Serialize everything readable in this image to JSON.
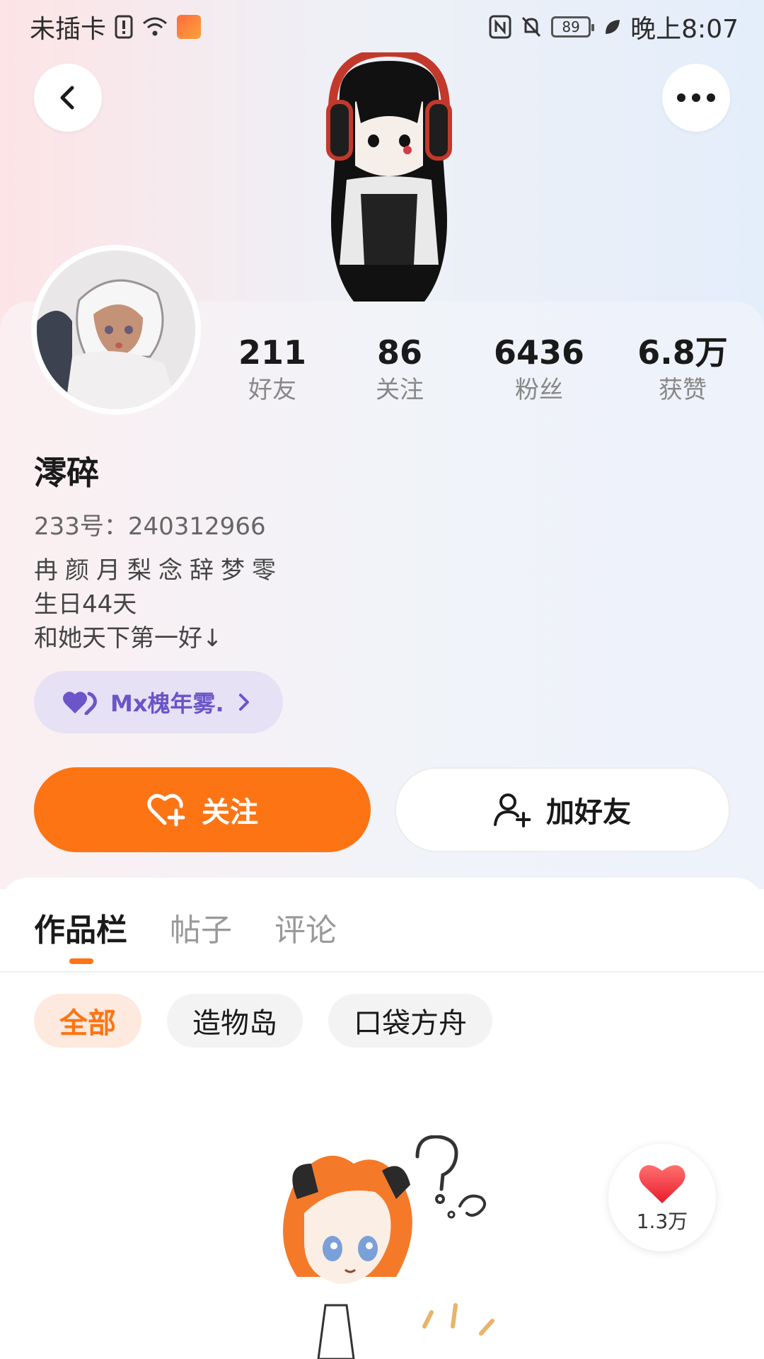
{
  "status_bar": {
    "carrier": "未插卡",
    "battery": "89",
    "time": "晚上8:07"
  },
  "profile": {
    "stats": [
      {
        "value": "211",
        "label": "好友"
      },
      {
        "value": "86",
        "label": "关注"
      },
      {
        "value": "6436",
        "label": "粉丝"
      },
      {
        "value": "6.8万",
        "label": "获赞"
      }
    ],
    "nickname": "澪碎",
    "uid": "233号：240312966",
    "bio": [
      "冉颜月梨念辞梦零",
      "生日44天",
      "和她天下第一好↓"
    ],
    "cp_chip": "Mx槐年雾."
  },
  "actions": {
    "follow": "关注",
    "add_friend": "加好友"
  },
  "tabs": [
    "作品栏",
    "帖子",
    "评论"
  ],
  "filters": [
    "全部",
    "造物岛",
    "口袋方舟"
  ],
  "like_fab": {
    "count": "1.3万"
  },
  "colors": {
    "accent": "#fd7414",
    "cp": "#6b55c9"
  }
}
